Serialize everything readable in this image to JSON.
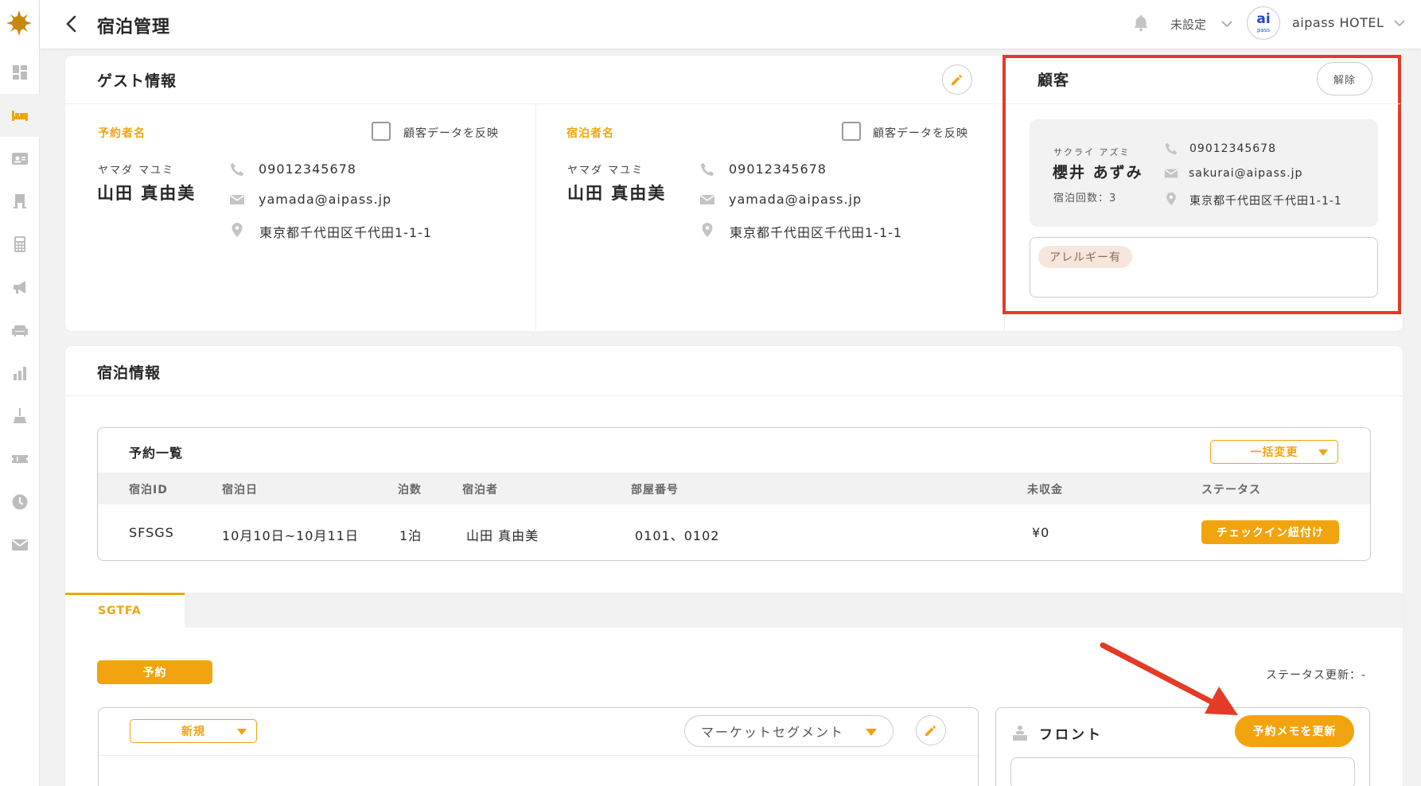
{
  "colors": {
    "accent": "#f2a40e",
    "highlight": "#e43a26",
    "text": "#272727",
    "muted": "#676767"
  },
  "sidebar": {
    "items": [
      {
        "name": "dashboard-icon"
      },
      {
        "name": "bed-icon",
        "active": true
      },
      {
        "name": "guest-card-icon"
      },
      {
        "name": "building-icon"
      },
      {
        "name": "calculator-icon"
      },
      {
        "name": "megaphone-icon"
      },
      {
        "name": "sofa-icon"
      },
      {
        "name": "bar-chart-icon"
      },
      {
        "name": "cleaning-icon"
      },
      {
        "name": "ticket-icon"
      },
      {
        "name": "clock-icon"
      },
      {
        "name": "mail-icon"
      }
    ]
  },
  "header": {
    "title": "宿泊管理",
    "status_select": "未設定",
    "hotel_name": "aipass HOTEL",
    "avatar_text": "ai",
    "avatar_subtext": "pass"
  },
  "guest_info": {
    "title": "ゲスト情報",
    "booker": {
      "label": "予約者名",
      "checkbox_label": "顧客データを反映",
      "kana": "ヤマダ マユミ",
      "name": "山田 真由美",
      "phone": "09012345678",
      "email": "yamada@aipass.jp",
      "address": "東京都千代田区千代田1-1-1"
    },
    "guest": {
      "label": "宿泊者名",
      "checkbox_label": "顧客データを反映",
      "kana": "ヤマダ マユミ",
      "name": "山田 真由美",
      "phone": "09012345678",
      "email": "yamada@aipass.jp",
      "address": "東京都千代田区千代田1-1-1"
    }
  },
  "customer": {
    "title": "顧客",
    "release_button": "解除",
    "kana": "サクライ アズミ",
    "name": "櫻井 あずみ",
    "stay_count": "宿泊回数：3",
    "phone": "09012345678",
    "email": "sakurai@aipass.jp",
    "address": "東京都千代田区千代田1-1-1",
    "tag": "アレルギー有"
  },
  "stay_info": {
    "title": "宿泊情報",
    "reservation_list": {
      "title": "予約一覧",
      "bulk_change": "一括変更",
      "columns": [
        "宿泊ID",
        "宿泊日",
        "泊数",
        "宿泊者",
        "部屋番号",
        "未収金",
        "ステータス"
      ],
      "rows": [
        {
          "id": "SFSGS",
          "dates": "10月10日~10月11日",
          "nights": "1泊",
          "guest": "山田 真由美",
          "rooms": "0101、0102",
          "unpaid": "¥0",
          "action": "チェックイン紐付け"
        }
      ]
    },
    "tab": "SGTFA",
    "status_badge": "予約",
    "status_update": "ステータス更新：-",
    "new_select": "新規",
    "segment_select": "マーケットセグメント",
    "front_label": "フロント",
    "update_memo_button": "予約メモを更新"
  }
}
